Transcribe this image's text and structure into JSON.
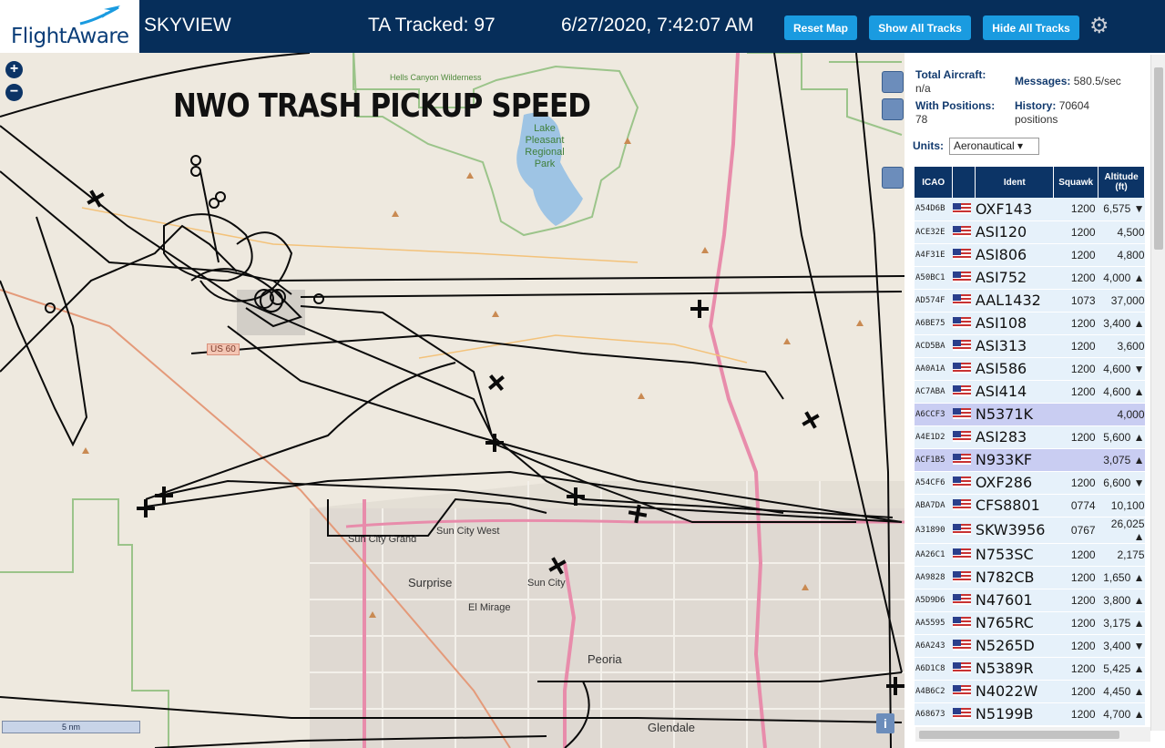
{
  "header": {
    "logo": "FlightAware",
    "title": "SKYVIEW",
    "tracked": "TA Tracked: 97",
    "datetime": "6/27/2020, 7:42:07 AM",
    "buttons": {
      "reset": "Reset Map",
      "show": "Show All Tracks",
      "hide": "Hide All Tracks"
    }
  },
  "map": {
    "overlay_title": "NWO TRASH PICKUP SPEED",
    "zoom_in": "+",
    "zoom_out": "−",
    "scale": "5 nm",
    "info": "i",
    "labels": {
      "hells_canyon": "Hells Canyon Wilderness",
      "lake_pleasant": "Lake Pleasant Regional Park",
      "us60": "US 60",
      "surprise": "Surprise",
      "el_mirage": "El Mirage",
      "sun_city": "Sun City",
      "sun_city_west": "Sun City West",
      "sun_city_grand": "Sun City Grand",
      "peoria": "Peoria",
      "glendale": "Glendale"
    }
  },
  "stats": {
    "total_label": "Total Aircraft:",
    "total_value": "n/a",
    "messages_label": "Messages:",
    "messages_value": "580.5/sec",
    "positions_label": "With Positions:",
    "positions_value": "78",
    "history_label": "History:",
    "history_value": "70604 positions",
    "units_label": "Units:",
    "units_value": "Aeronautical ▾"
  },
  "table": {
    "headers": {
      "icao": "ICAO",
      "ident": "Ident",
      "squawk": "Squawk",
      "altitude": "Altitude (ft)"
    },
    "rows": [
      {
        "icao": "A54D6B",
        "ident": "OXF143",
        "squawk": "1200",
        "alt": "6,575 ▼"
      },
      {
        "icao": "ACE32E",
        "ident": "ASI120",
        "squawk": "1200",
        "alt": "4,500"
      },
      {
        "icao": "A4F31E",
        "ident": "ASI806",
        "squawk": "1200",
        "alt": "4,800"
      },
      {
        "icao": "A50BC1",
        "ident": "ASI752",
        "squawk": "1200",
        "alt": "4,000 ▲"
      },
      {
        "icao": "AD574F",
        "ident": "AAL1432",
        "squawk": "1073",
        "alt": "37,000"
      },
      {
        "icao": "A6BE75",
        "ident": "ASI108",
        "squawk": "1200",
        "alt": "3,400 ▲"
      },
      {
        "icao": "ACD5BA",
        "ident": "ASI313",
        "squawk": "1200",
        "alt": "3,600"
      },
      {
        "icao": "AA0A1A",
        "ident": "ASI586",
        "squawk": "1200",
        "alt": "4,600 ▼"
      },
      {
        "icao": "AC7ABA",
        "ident": "ASI414",
        "squawk": "1200",
        "alt": "4,600 ▲"
      },
      {
        "icao": "A6CCF3",
        "ident": "N5371K",
        "squawk": "",
        "alt": "4,000",
        "hl": true
      },
      {
        "icao": "A4E1D2",
        "ident": "ASI283",
        "squawk": "1200",
        "alt": "5,600 ▲"
      },
      {
        "icao": "ACF1B5",
        "ident": "N933KF",
        "squawk": "",
        "alt": "3,075 ▲",
        "hl": true
      },
      {
        "icao": "A54CF6",
        "ident": "OXF286",
        "squawk": "1200",
        "alt": "6,600 ▼"
      },
      {
        "icao": "ABA7DA",
        "ident": "CFS8801",
        "squawk": "0774",
        "alt": "10,100"
      },
      {
        "icao": "A31890",
        "ident": "SKW3956",
        "squawk": "0767",
        "alt": "26,025 ▲"
      },
      {
        "icao": "AA26C1",
        "ident": "N753SC",
        "squawk": "1200",
        "alt": "2,175"
      },
      {
        "icao": "AA9828",
        "ident": "N782CB",
        "squawk": "1200",
        "alt": "1,650 ▲"
      },
      {
        "icao": "A5D9D6",
        "ident": "N47601",
        "squawk": "1200",
        "alt": "3,800 ▲"
      },
      {
        "icao": "AA5595",
        "ident": "N765RC",
        "squawk": "1200",
        "alt": "3,175 ▲"
      },
      {
        "icao": "A6A243",
        "ident": "N5265D",
        "squawk": "1200",
        "alt": "3,400 ▼"
      },
      {
        "icao": "A6D1C8",
        "ident": "N5389R",
        "squawk": "1200",
        "alt": "5,425 ▲"
      },
      {
        "icao": "A4B6C2",
        "ident": "N4022W",
        "squawk": "1200",
        "alt": "4,450 ▲"
      },
      {
        "icao": "A68673",
        "ident": "N5199B",
        "squawk": "1200",
        "alt": "4,700 ▲"
      }
    ]
  },
  "colors": {
    "header": "#062e5a",
    "button": "#1a9be0",
    "table_header": "#0c3466",
    "row": "#e6f1fa",
    "row_highlight": "#c9cdf2"
  }
}
